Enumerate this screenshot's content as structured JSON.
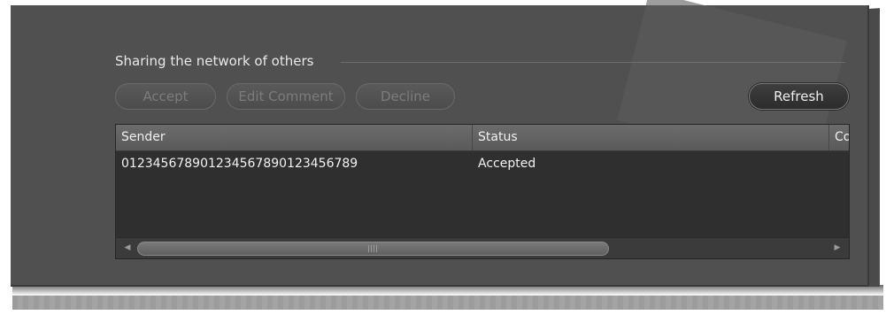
{
  "section": {
    "title": "Sharing the network of others"
  },
  "toolbar": {
    "accept_label": "Accept",
    "edit_comment_label": "Edit Comment",
    "decline_label": "Decline",
    "refresh_label": "Refresh"
  },
  "table": {
    "columns": [
      "Sender",
      "Status",
      "Co"
    ],
    "rows": [
      {
        "sender": "012345678901234567890123456789",
        "status": "Accepted"
      }
    ]
  },
  "colors": {
    "panel_bg": "#505050",
    "grid_bg": "#2f2f2f",
    "header_bg": "#636363",
    "disabled_text": "#7c7c7c",
    "text": "#f2f2f2"
  },
  "icons": {
    "scroll_left": "triangle-left-icon",
    "scroll_right": "triangle-right-icon",
    "thumb_grip": "grip-icon"
  }
}
